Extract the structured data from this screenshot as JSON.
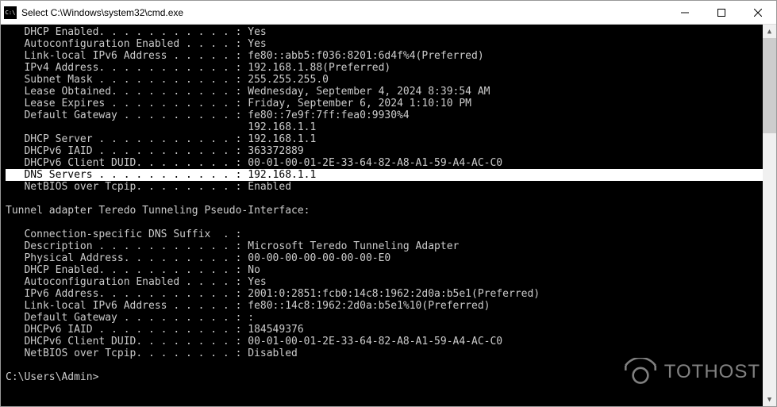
{
  "window": {
    "title": "Select C:\\Windows\\system32\\cmd.exe",
    "icon": "C:\\"
  },
  "watermark": "TOTHOST",
  "prompt": "C:\\Users\\Admin>",
  "lines": [
    {
      "indented": true,
      "label": "DHCP Enabled. . . . . . . . . . . :",
      "value": "Yes"
    },
    {
      "indented": true,
      "label": "Autoconfiguration Enabled . . . . :",
      "value": "Yes"
    },
    {
      "indented": true,
      "label": "Link-local IPv6 Address . . . . . :",
      "value": "fe80::abb5:f036:8201:6d4f%4(Preferred)"
    },
    {
      "indented": true,
      "label": "IPv4 Address. . . . . . . . . . . :",
      "value": "192.168.1.88(Preferred)"
    },
    {
      "indented": true,
      "label": "Subnet Mask . . . . . . . . . . . :",
      "value": "255.255.255.0"
    },
    {
      "indented": true,
      "label": "Lease Obtained. . . . . . . . . . :",
      "value": "Wednesday, September 4, 2024 8:39:54 AM"
    },
    {
      "indented": true,
      "label": "Lease Expires . . . . . . . . . . :",
      "value": "Friday, September 6, 2024 1:10:10 PM"
    },
    {
      "indented": true,
      "label": "Default Gateway . . . . . . . . . :",
      "value": "fe80::7e9f:7ff:fea0:9930%4"
    },
    {
      "indented": true,
      "label": "                                   ",
      "value": "192.168.1.1"
    },
    {
      "indented": true,
      "label": "DHCP Server . . . . . . . . . . . :",
      "value": "192.168.1.1"
    },
    {
      "indented": true,
      "label": "DHCPv6 IAID . . . . . . . . . . . :",
      "value": "363372889"
    },
    {
      "indented": true,
      "label": "DHCPv6 Client DUID. . . . . . . . :",
      "value": "00-01-00-01-2E-33-64-82-A8-A1-59-A4-AC-C0"
    },
    {
      "indented": true,
      "label": "DNS Servers . . . . . . . . . . . :",
      "value": "192.168.1.1",
      "selected": true
    },
    {
      "indented": true,
      "label": "NetBIOS over Tcpip. . . . . . . . :",
      "value": "Enabled"
    },
    {
      "blank": true
    },
    {
      "indented": false,
      "text": "Tunnel adapter Teredo Tunneling Pseudo-Interface:"
    },
    {
      "blank": true
    },
    {
      "indented": true,
      "label": "Connection-specific DNS Suffix  . :",
      "value": ""
    },
    {
      "indented": true,
      "label": "Description . . . . . . . . . . . :",
      "value": "Microsoft Teredo Tunneling Adapter"
    },
    {
      "indented": true,
      "label": "Physical Address. . . . . . . . . :",
      "value": "00-00-00-00-00-00-00-E0"
    },
    {
      "indented": true,
      "label": "DHCP Enabled. . . . . . . . . . . :",
      "value": "No"
    },
    {
      "indented": true,
      "label": "Autoconfiguration Enabled . . . . :",
      "value": "Yes"
    },
    {
      "indented": true,
      "label": "IPv6 Address. . . . . . . . . . . :",
      "value": "2001:0:2851:fcb0:14c8:1962:2d0a:b5e1(Preferred)"
    },
    {
      "indented": true,
      "label": "Link-local IPv6 Address . . . . . :",
      "value": "fe80::14c8:1962:2d0a:b5e1%10(Preferred)"
    },
    {
      "indented": true,
      "label": "Default Gateway . . . . . . . . . :",
      "value": ":"
    },
    {
      "indented": true,
      "label": "DHCPv6 IAID . . . . . . . . . . . :",
      "value": "184549376"
    },
    {
      "indented": true,
      "label": "DHCPv6 Client DUID. . . . . . . . :",
      "value": "00-01-00-01-2E-33-64-82-A8-A1-59-A4-AC-C0"
    },
    {
      "indented": true,
      "label": "NetBIOS over Tcpip. . . . . . . . :",
      "value": "Disabled"
    }
  ]
}
